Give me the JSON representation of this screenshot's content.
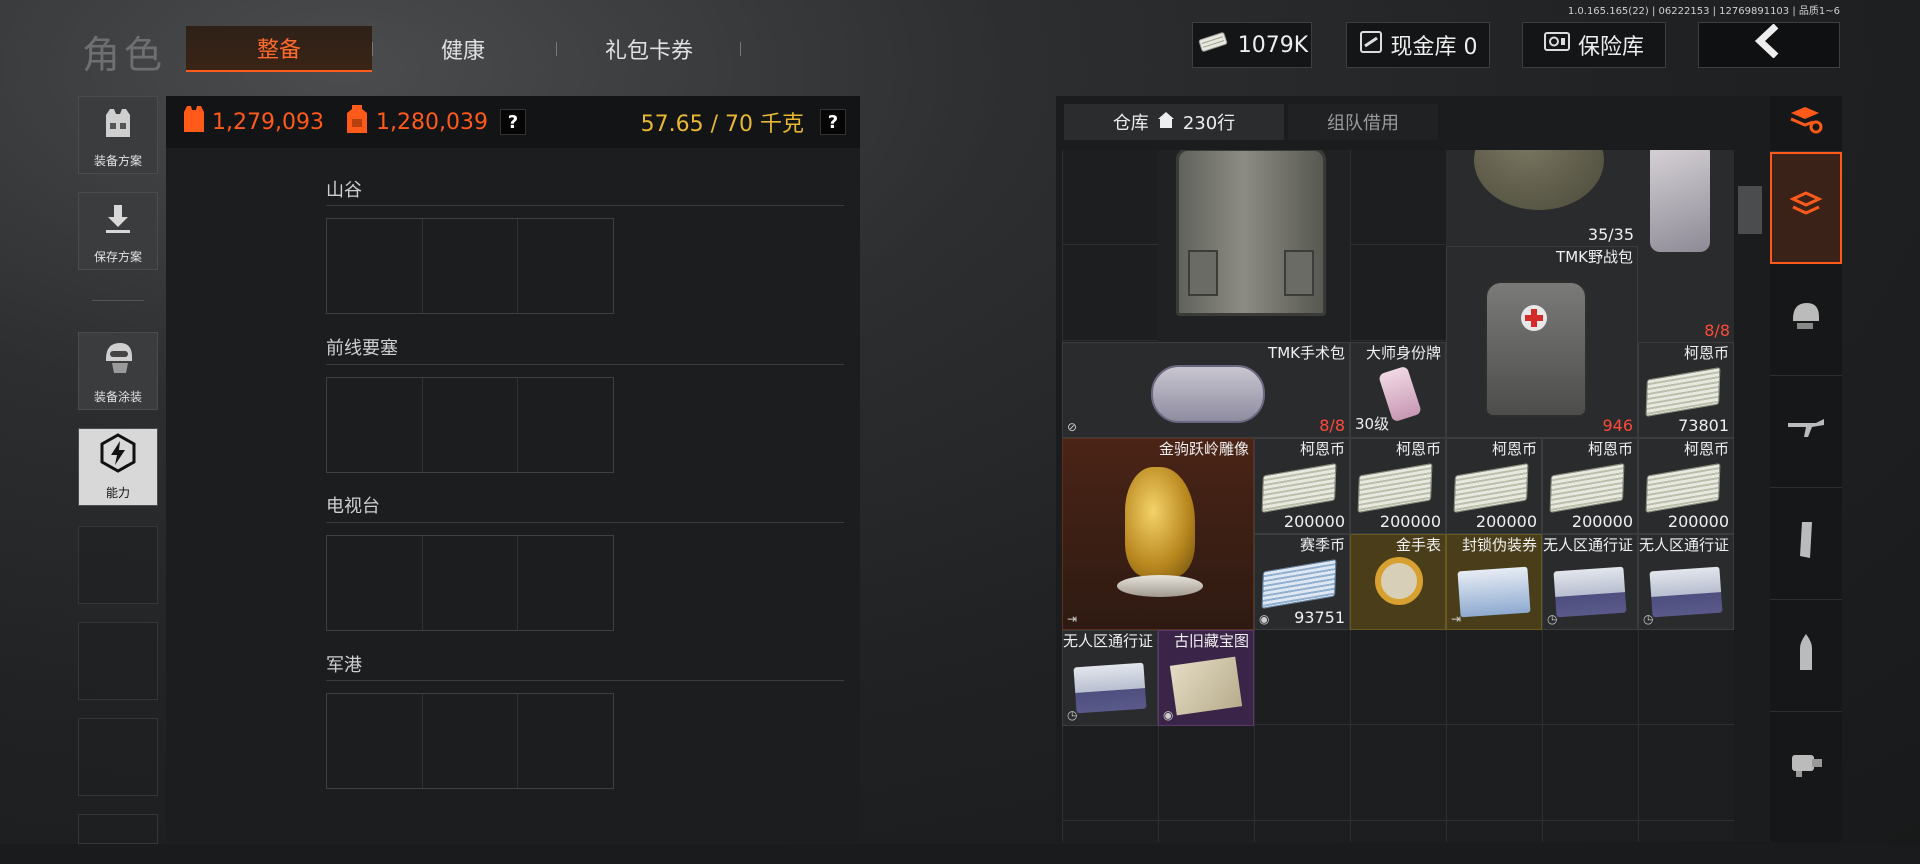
{
  "build_info": "1.0.165.165(22) | 06222153 | 12769891103 | 品质1~6",
  "header": {
    "title": "角色",
    "tabs": [
      {
        "label": "整备",
        "active": true
      },
      {
        "label": "健康",
        "active": false
      },
      {
        "label": "礼包卡券",
        "active": false
      }
    ],
    "currency": {
      "coins": "1079K",
      "cash_vault_label": "现金库 0",
      "safe_label": "保险库"
    },
    "back_icon": "chevron-left-icon"
  },
  "sidebar": {
    "buttons": [
      {
        "label": "装备方案",
        "icon": "vest-icon"
      },
      {
        "label": "保存方案",
        "icon": "download-icon"
      },
      {
        "label": "装备涂装",
        "icon": "helmet-icon"
      },
      {
        "label": "能力",
        "icon": "ability-icon",
        "active": true
      }
    ]
  },
  "stats": {
    "value_1": "1,279,093",
    "value_2": "1,280,039",
    "help": "?",
    "weight": "57.65 / 70 千克",
    "accent_color": "#ff5a1a",
    "weight_color": "#e8b830"
  },
  "maps": [
    {
      "name": "山谷"
    },
    {
      "name": "前线要塞"
    },
    {
      "name": "电视台"
    },
    {
      "name": "军港"
    }
  ],
  "warehouse": {
    "tab_warehouse": "仓库",
    "rows": "230行",
    "tab_team": "组队借用",
    "items": {
      "helmet_count": "35/35",
      "backpack_top_count": "8/8",
      "tmk_field_pack": {
        "name": "TMK野战包",
        "count": "946"
      },
      "tmk_surgery_pack": {
        "name": "TMK手术包",
        "count": "8/8"
      },
      "master_tag": {
        "name": "大师身份牌",
        "level": "30级"
      },
      "kn_coin_1": {
        "name": "柯恩币",
        "count": "73801"
      },
      "statue": {
        "name": "金驹跃岭雕像"
      },
      "kn_coin_row": [
        {
          "name": "柯恩币",
          "count": "200000"
        },
        {
          "name": "柯恩币",
          "count": "200000"
        },
        {
          "name": "柯恩币",
          "count": "200000"
        },
        {
          "name": "柯恩币",
          "count": "200000"
        },
        {
          "name": "柯恩币",
          "count": "200000"
        }
      ],
      "season_coin": {
        "name": "赛季币",
        "count": "93751"
      },
      "gold_watch": {
        "name": "金手表"
      },
      "sealed_voucher": {
        "name": "封锁伪装券"
      },
      "nomans_pass_1": {
        "name": "无人区通行证"
      },
      "nomans_pass_2": {
        "name": "无人区通行证"
      },
      "nomans_pass_3": {
        "name": "无人区通行证"
      },
      "treasure_map": {
        "name": "古旧藏宝图"
      }
    }
  },
  "right_tools": [
    "sort-icon",
    "layers-icon",
    "helmet-icon",
    "rifle-icon",
    "magazine-icon",
    "ammo-icon",
    "scope-icon"
  ]
}
